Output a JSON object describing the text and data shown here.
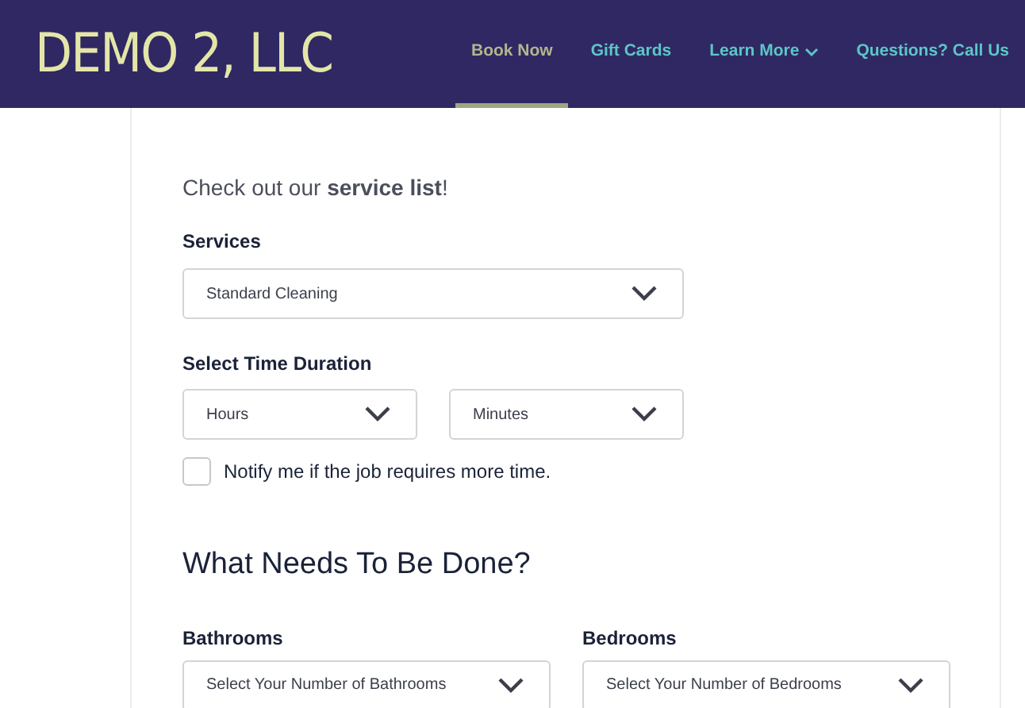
{
  "header": {
    "logo": "DEMO 2, LLC",
    "nav": [
      {
        "label": "Book Now",
        "selected": true,
        "dropdown": false
      },
      {
        "label": "Gift Cards",
        "selected": false,
        "dropdown": false
      },
      {
        "label": "Learn More",
        "selected": false,
        "dropdown": true
      },
      {
        "label": "Questions? Call Us",
        "selected": false,
        "dropdown": false
      }
    ]
  },
  "intro": "Check out our **service list**!",
  "services": {
    "label": "Services",
    "value": "Standard Cleaning"
  },
  "time_duration": {
    "label": "Select Time Duration",
    "hours": "Hours",
    "minutes": "Minutes"
  },
  "notify": {
    "label": "Notify me if the job requires more time.",
    "checked": false
  },
  "section_title": "What Needs To Be Done?",
  "rooms": [
    {
      "label": "Bathrooms",
      "value": "Select Your Number of Bathrooms"
    },
    {
      "label": "Bedrooms",
      "value": "Select Your Number of Bedrooms"
    }
  ]
}
